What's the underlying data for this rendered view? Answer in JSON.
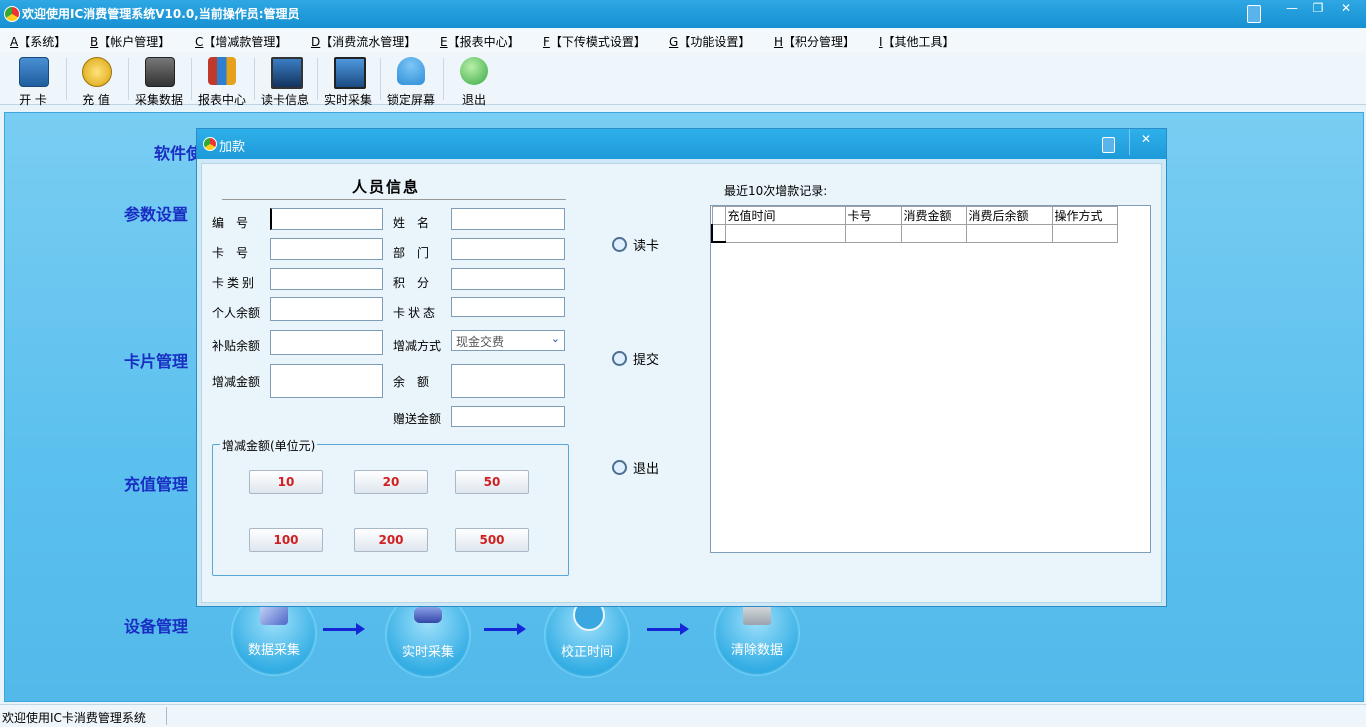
{
  "window": {
    "title": "欢迎使用IC消费管理系统V10.0,当前操作员:管理员",
    "minimize": "—",
    "restore": "❐",
    "close": "✕"
  },
  "menu": [
    {
      "key": "A",
      "label": "【系统】"
    },
    {
      "key": "B",
      "label": "【帐户管理】"
    },
    {
      "key": "C",
      "label": "【增减款管理】"
    },
    {
      "key": "D",
      "label": "【消费流水管理】"
    },
    {
      "key": "E",
      "label": "【报表中心】"
    },
    {
      "key": "F",
      "label": "【下传模式设置】"
    },
    {
      "key": "G",
      "label": "【功能设置】"
    },
    {
      "key": "H",
      "label": "【积分管理】"
    },
    {
      "key": "I",
      "label": "【其他工具】"
    }
  ],
  "toolbar": [
    {
      "label": "开 卡",
      "icon": "user-card-icon",
      "color": "#2b6fb3"
    },
    {
      "label": "充 值",
      "icon": "coins-icon",
      "color": "#d8a20c"
    },
    {
      "label": "采集数据",
      "icon": "floppy-disk-icon",
      "color": "#555555"
    },
    {
      "label": "报表中心",
      "icon": "books-icon",
      "color": "#c0392b"
    },
    {
      "label": "读卡信息",
      "icon": "monitor-icon",
      "color": "#1f4f8a"
    },
    {
      "label": "实时采集",
      "icon": "screen-icon",
      "color": "#2a5f9e"
    },
    {
      "label": "锁定屏幕",
      "icon": "user-lock-icon",
      "color": "#2e8fd8"
    },
    {
      "label": "退出",
      "icon": "globe-exit-icon",
      "color": "#38a845"
    }
  ],
  "sections": {
    "software": "软件使",
    "params": "参数设置",
    "card": "卡片管理",
    "recharge": "充值管理",
    "device": "设备管理"
  },
  "device_flow": [
    "数据采集",
    "实时采集",
    "校正时间",
    "清除数据"
  ],
  "status": "欢迎使用IC卡消费管理系统",
  "dialog": {
    "title": "加款",
    "close": "✕",
    "person_header": "人员信息",
    "fields": {
      "id": "编　号",
      "name": "姓　名",
      "card_no": "卡　号",
      "dept": "部　门",
      "card_type": "卡类别",
      "points": "积　分",
      "personal_balance": "个人余额",
      "card_status": "卡状态",
      "subsidy_balance": "补贴余额",
      "method": "增减方式",
      "amount": "增减金额",
      "balance": "余　额",
      "gift_amount": "赠送金额"
    },
    "method_value": "现金交费",
    "amount_group": "增减金额(单位元)",
    "amounts": [
      "10",
      "20",
      "50",
      "100",
      "200",
      "500"
    ],
    "actions": {
      "read_card": "读卡",
      "submit": "提交",
      "exit": "退出"
    },
    "records_title": "最近10次增款记录:",
    "records_columns": [
      "充值时间",
      "卡号",
      "消费金额",
      "消费后余额",
      "操作方式"
    ]
  }
}
